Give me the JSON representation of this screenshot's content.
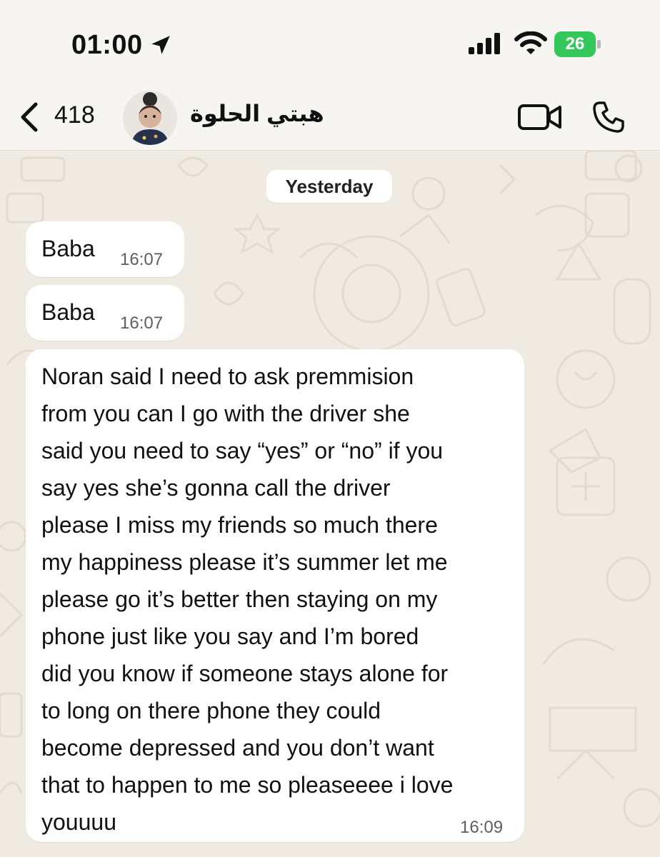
{
  "status_bar": {
    "time": "01:00",
    "battery_level": "26",
    "icons": [
      "location-arrow-icon",
      "cellular-signal-icon",
      "wifi-icon",
      "battery-charging-icon"
    ]
  },
  "header": {
    "back_count": "418",
    "contact_name": "هبتي الحلوة",
    "icons": [
      "chevron-left-icon",
      "video-call-icon",
      "phone-call-icon"
    ]
  },
  "chat": {
    "date_chip": "Yesterday",
    "messages": [
      {
        "text": "Baba",
        "time": "16:07"
      },
      {
        "text": "Baba",
        "time": "16:07"
      },
      {
        "text": "Noran said I need to ask premmision\nfrom you can I go with the driver she\nsaid you need to say “yes” or “no” if you\nsay yes she’s gonna call the driver\nplease I miss my friends so much there\nmy happiness please it’s summer let me\nplease go it’s better then staying on my\nphone just like you say and I’m bored\ndid you know if someone stays alone for\nto long on there phone they could\nbecome depressed and you don’t want\nthat to happen to me so pleaseeee i love\nyouuuu",
        "time": "16:09"
      }
    ]
  },
  "colors": {
    "battery": "#34c759",
    "chat_background": "#efeae2",
    "bubble": "#ffffff"
  }
}
